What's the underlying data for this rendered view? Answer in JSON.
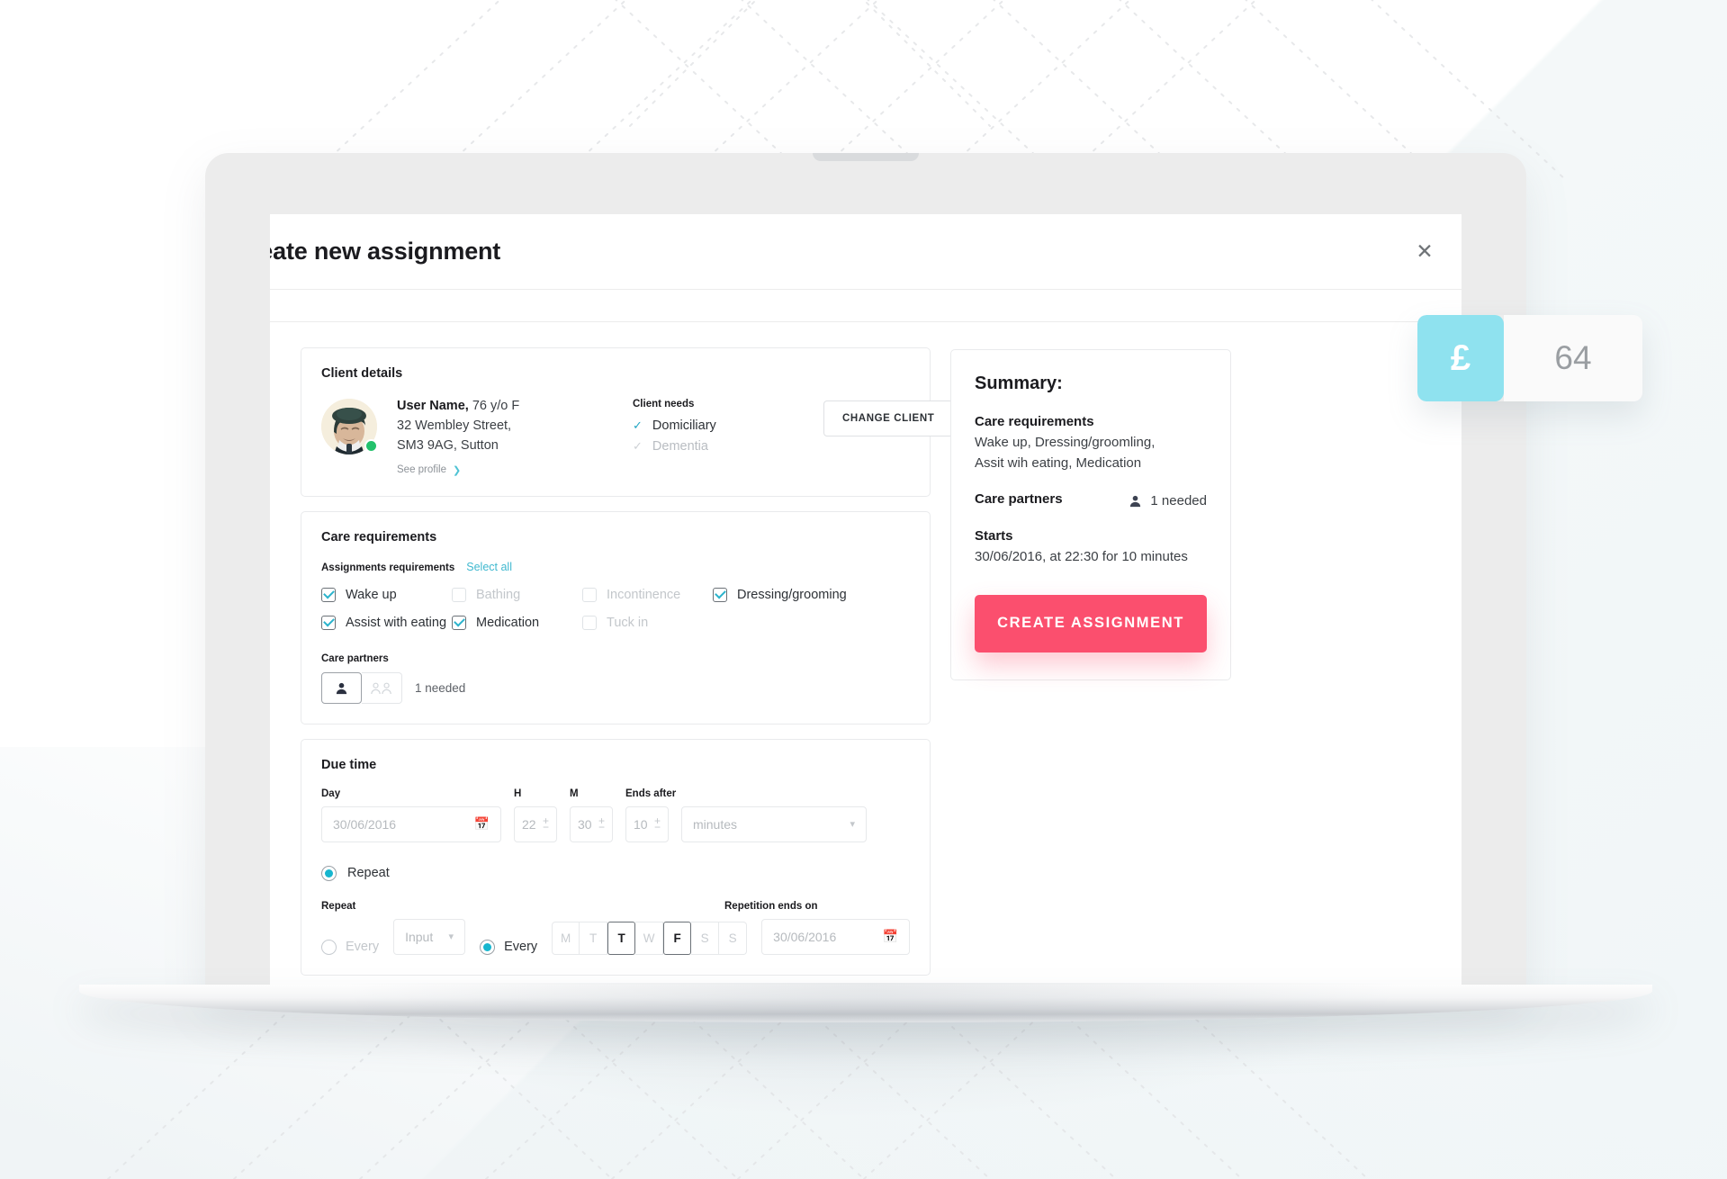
{
  "modal": {
    "title": "reate new assignment",
    "close_icon": "close-icon"
  },
  "client_details": {
    "section_title": "Client details",
    "name": "User Name,",
    "age_sex": "76 y/o F",
    "address_line1": "32 Wembley Street,",
    "address_line2": "SM3 9AG, Sutton",
    "see_profile": "See profile",
    "needs_label": "Client needs",
    "needs": [
      {
        "label": "Domiciliary",
        "active": true
      },
      {
        "label": "Dementia",
        "active": false
      }
    ],
    "change_client_button": "CHANGE CLIENT"
  },
  "care_requirements": {
    "section_title": "Care requirements",
    "assignments_label": "Assignments requirements",
    "select_all": "Select all",
    "options": [
      {
        "label": "Wake up",
        "checked": true
      },
      {
        "label": "Bathing",
        "checked": false
      },
      {
        "label": "Incontinence",
        "checked": false
      },
      {
        "label": "Dressing/grooming",
        "checked": true
      },
      {
        "label": "Assist with eating",
        "checked": true
      },
      {
        "label": "Medication",
        "checked": true
      },
      {
        "label": "Tuck in",
        "checked": false
      }
    ],
    "care_partners_label": "Care partners",
    "care_partners_value": "1 needed",
    "partner_options": [
      "single-person-icon",
      "two-persons-icon"
    ]
  },
  "due_time": {
    "section_title": "Due time",
    "day_label": "Day",
    "day_value": "30/06/2016",
    "hour_label": "H",
    "hour_value": "22",
    "minute_label": "M",
    "minute_value": "30",
    "ends_after_label": "Ends after",
    "ends_after_value": "10",
    "duration_unit_placeholder": "minutes",
    "repeat_toggle_label": "Repeat",
    "repeat_label": "Repeat",
    "every_interval_label": "Every",
    "interval_input_placeholder": "Input",
    "every_days_label": "Every",
    "days": [
      {
        "letter": "M",
        "selected": false
      },
      {
        "letter": "T",
        "selected": false
      },
      {
        "letter": "T",
        "selected": true
      },
      {
        "letter": "W",
        "selected": false
      },
      {
        "letter": "F",
        "selected": true
      },
      {
        "letter": "S",
        "selected": false
      },
      {
        "letter": "S",
        "selected": false
      }
    ],
    "repetition_ends_label": "Repetition ends on",
    "repetition_ends_value": "30/06/2016"
  },
  "summary": {
    "title": "Summary:",
    "care_requirements_label": "Care requirements",
    "care_requirements_value_1": "Wake up, Dressing/groomling,",
    "care_requirements_value_2": "Assit wih eating, Medication",
    "care_partners_label": "Care partners",
    "care_partners_value": "1 needed",
    "starts_label": "Starts",
    "starts_value": "30/06/2016, at 22:30 for 10 minutes",
    "cta_label": "CREATE ASSIGNMENT"
  },
  "price_badge": {
    "currency": "£",
    "amount": "64"
  },
  "colors": {
    "accent_pink": "#fb4f6e",
    "accent_teal": "#3fb8cf",
    "badge_cyan": "#8fe2ef",
    "status_green": "#23c16b"
  }
}
